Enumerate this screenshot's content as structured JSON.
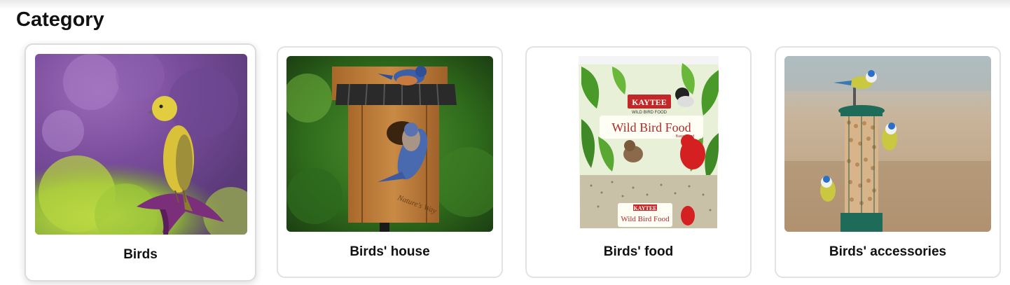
{
  "section": {
    "title": "Category"
  },
  "categories": [
    {
      "label": "Birds",
      "image": "yellow-warbler-photo"
    },
    {
      "label": "Birds' house",
      "image": "bluebird-house-photo"
    },
    {
      "label": "Birds' food",
      "image": "wild-bird-food-bag-photo"
    },
    {
      "label": "Birds' accessories",
      "image": "bird-feeder-photo"
    }
  ],
  "product_packaging": {
    "brand": "KAYTEE",
    "subtitle": "WILD BIRD FOOD",
    "name": "Wild Bird Food",
    "variant": "Basic Blend"
  },
  "birdhouse_branding": "Nature's Way"
}
